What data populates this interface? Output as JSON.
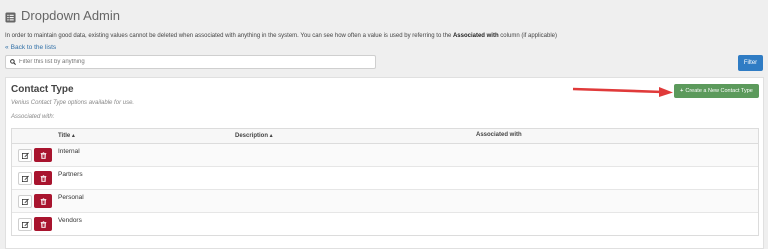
{
  "header": {
    "title": "Dropdown Admin",
    "icon": "list-icon"
  },
  "info": {
    "text_before": "In order to maintain good data, existing values cannot be deleted when associated with anything in the system. You can see how often a value is used by referring to the ",
    "bold": "Associated with",
    "text_after": " column (if applicable)"
  },
  "back_link": {
    "label": "Back to the lists",
    "icon": "double-chevron-left-icon"
  },
  "search": {
    "placeholder": "Filter this list by anything",
    "value": "",
    "icon": "search-icon"
  },
  "filter_button": {
    "label": "Filter"
  },
  "panel": {
    "title": "Contact Type",
    "subtitle": "Venius Contact Type options available for use.",
    "associated_label": "Associated with:",
    "create_button": "Create a New Contact Type",
    "create_icon": "plus-icon"
  },
  "table": {
    "columns": [
      "Title",
      "Description",
      "Associated with"
    ],
    "rows": [
      {
        "title": "Internal"
      },
      {
        "title": "Partners"
      },
      {
        "title": "Personal"
      },
      {
        "title": "Vendors"
      }
    ]
  },
  "colors": {
    "create_button": "#5c9a5c",
    "filter_button": "#2f7cc4",
    "delete_button": "#a8142e",
    "annotation_arrow": "#e03a3a"
  }
}
